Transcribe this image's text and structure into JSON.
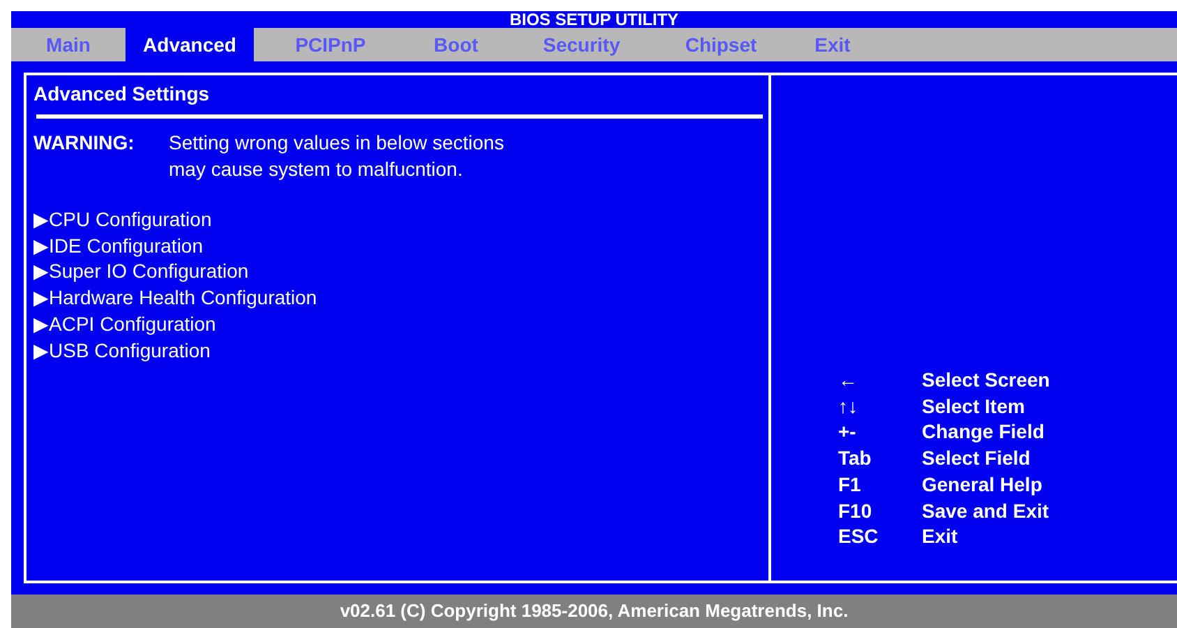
{
  "window": {
    "title": "BIOS SETUP UTILITY"
  },
  "tabs": [
    {
      "label": "Main",
      "selected": false
    },
    {
      "label": "Advanced",
      "selected": true
    },
    {
      "label": "PCIPnP",
      "selected": false
    },
    {
      "label": "Boot",
      "selected": false
    },
    {
      "label": "Security",
      "selected": false
    },
    {
      "label": "Chipset",
      "selected": false
    },
    {
      "label": "Exit",
      "selected": false
    }
  ],
  "panel": {
    "title": "Advanced Settings",
    "warning_label": "WARNING:",
    "warning_lines": [
      "Setting wrong values in below sections",
      "may cause system to malfucntion."
    ],
    "items": [
      {
        "marker": "▶",
        "label": "CPU Configuration"
      },
      {
        "marker": "▶",
        "label": "IDE Configuration"
      },
      {
        "marker": "▶",
        "label": "Super IO Configuration"
      },
      {
        "marker": "▶",
        "label": "Hardware Health Configuration"
      },
      {
        "marker": "▶",
        "label": "ACPI Configuration"
      },
      {
        "marker": "▶",
        "label": "USB Configuration"
      }
    ]
  },
  "help": [
    {
      "key": "←",
      "action": "Select Screen"
    },
    {
      "key": "↑↓",
      "action": "Select Item"
    },
    {
      "key": "+-",
      "action": "Change Field"
    },
    {
      "key": "Tab",
      "action": "Select Field"
    },
    {
      "key": "F1",
      "action": "General Help"
    },
    {
      "key": "F10",
      "action": "Save and Exit"
    },
    {
      "key": "ESC",
      "action": "Exit"
    }
  ],
  "status_bar": "v02.61 (C) Copyright 1985-2006, American Megatrends, Inc."
}
